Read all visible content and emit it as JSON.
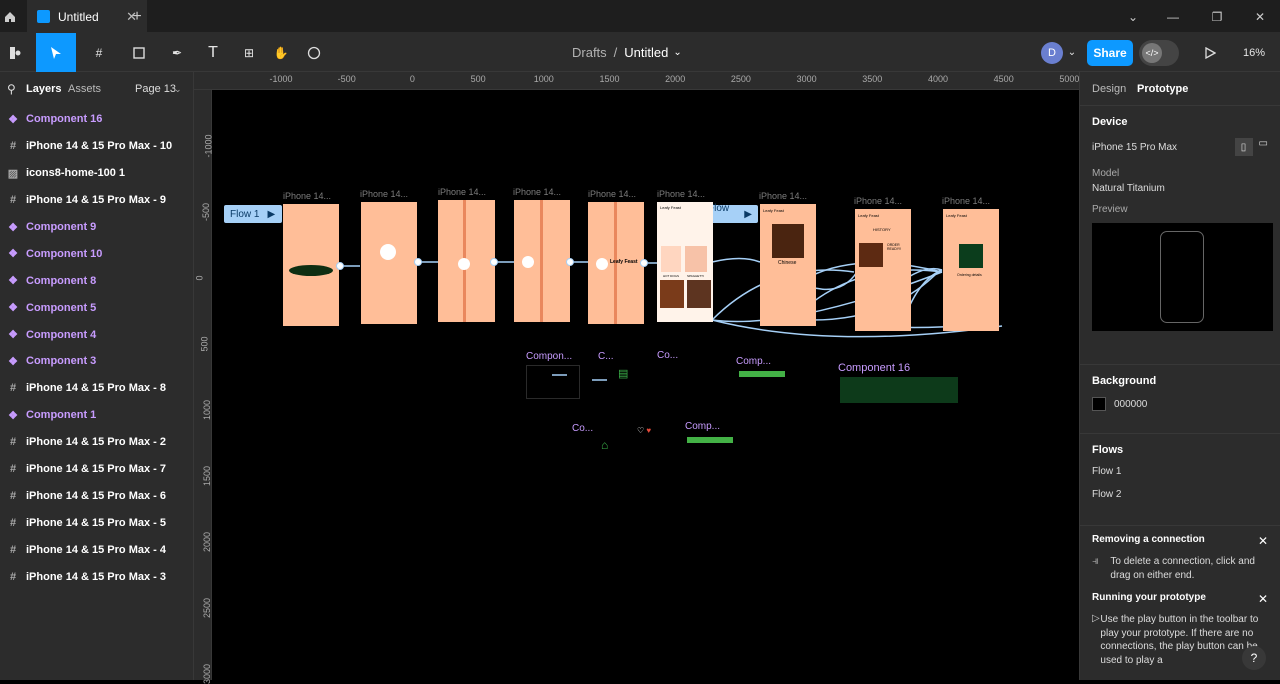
{
  "tabbar": {
    "tab_title": "Untitled"
  },
  "toolbar": {
    "breadcrumb_parent": "Drafts",
    "breadcrumb_separator": "/",
    "file_name": "Untitled",
    "avatar_initial": "D",
    "share_label": "Share",
    "zoom": "16%"
  },
  "sidebar": {
    "tab_layers": "Layers",
    "tab_assets": "Assets",
    "page": "Page 13",
    "layers": [
      {
        "label": "Component 16",
        "type": "component"
      },
      {
        "label": "iPhone 14 & 15 Pro Max - 10",
        "type": "frame"
      },
      {
        "label": "icons8-home-100 1",
        "type": "image"
      },
      {
        "label": "iPhone 14 & 15 Pro Max - 9",
        "type": "frame"
      },
      {
        "label": "Component 9",
        "type": "component"
      },
      {
        "label": "Component 10",
        "type": "component"
      },
      {
        "label": "Component 8",
        "type": "component"
      },
      {
        "label": "Component 5",
        "type": "component"
      },
      {
        "label": "Component 4",
        "type": "component"
      },
      {
        "label": "Component 3",
        "type": "component"
      },
      {
        "label": "iPhone 14 & 15 Pro Max - 8",
        "type": "frame"
      },
      {
        "label": "Component 1",
        "type": "component"
      },
      {
        "label": "iPhone 14 & 15 Pro Max - 2",
        "type": "frame"
      },
      {
        "label": "iPhone 14 & 15 Pro Max - 7",
        "type": "frame"
      },
      {
        "label": "iPhone 14 & 15 Pro Max - 6",
        "type": "frame"
      },
      {
        "label": "iPhone 14 & 15 Pro Max - 5",
        "type": "frame"
      },
      {
        "label": "iPhone 14 & 15 Pro Max - 4",
        "type": "frame"
      },
      {
        "label": "iPhone 14 & 15 Pro Max - 3",
        "type": "frame"
      }
    ]
  },
  "rulers": {
    "top": [
      "-1000",
      "-500",
      "0",
      "500",
      "1000",
      "1500",
      "2000",
      "2500",
      "3000",
      "3500",
      "4000",
      "4500",
      "5000"
    ],
    "left": [
      "-1000",
      "-500",
      "0",
      "500",
      "1000",
      "1500",
      "2000",
      "2500",
      "3000"
    ]
  },
  "canvas": {
    "frame_label": "iPhone 14...",
    "flow1": "Flow 1",
    "flow2": "Flow 2",
    "brand": "Leafy Feast",
    "screen_chinese": "Chinese",
    "screen_history": "HISTORY",
    "screen_order_ready": "ORDER READY!!",
    "screen_ordering": "Ordering details",
    "screen_hot_dogs": "HOT DOGS",
    "screen_spaghetti": "SPAGHETTI",
    "components": {
      "c1": "Compon...",
      "c2": "C...",
      "c3": "Co...",
      "c4": "Comp...",
      "c16": "Component 16",
      "c5": "Co...",
      "c6": "Comp..."
    }
  },
  "rightpanel": {
    "tab_design": "Design",
    "tab_prototype": "Prototype",
    "device_heading": "Device",
    "device": "iPhone 15 Pro Max",
    "model_label": "Model",
    "model": "Natural Titanium",
    "preview_label": "Preview",
    "background_heading": "Background",
    "background_hex": "000000",
    "flows_heading": "Flows",
    "flows": [
      "Flow 1",
      "Flow 2"
    ],
    "tip1_title": "Removing a connection",
    "tip1_text": "To delete a connection, click and drag on either end.",
    "tip2_title": "Running your prototype",
    "tip2_text": "Use the play button in the toolbar to play your prototype. If there are no connections, the play button can be used to play a"
  },
  "colors": {
    "accent": "#0d99ff",
    "component": "#c89cff",
    "frame_fill": "#ffbe98",
    "connector": "#a6d0f7"
  }
}
